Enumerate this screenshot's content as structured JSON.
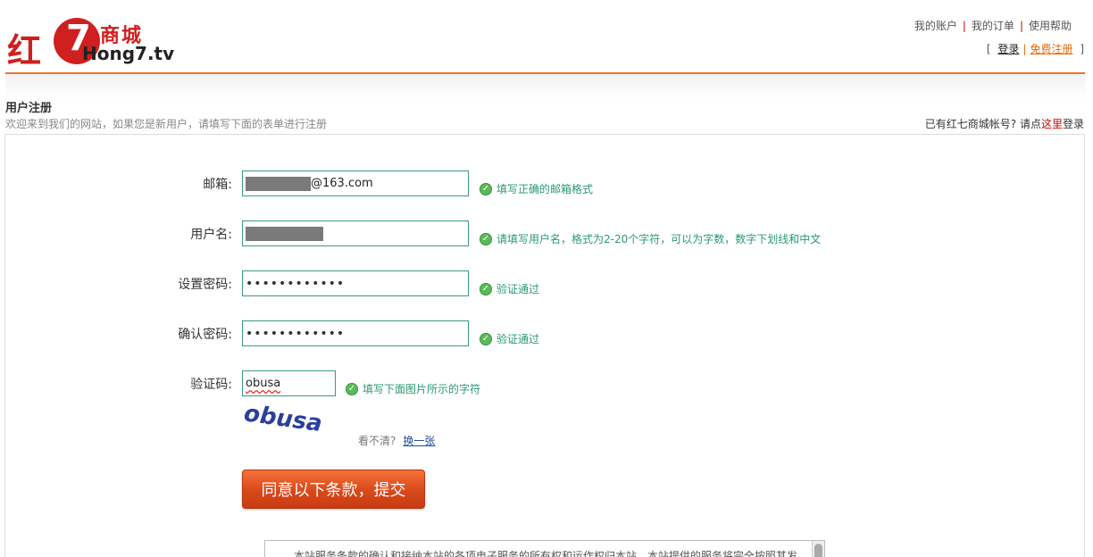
{
  "logo": {
    "red_char": "红",
    "seven": "7",
    "shop": "商城",
    "url": "Hong7.tv"
  },
  "top_links": [
    {
      "label": "我的账户"
    },
    {
      "label": "我的订单"
    },
    {
      "label": "使用帮助"
    }
  ],
  "auth": {
    "open": "[",
    "login": "登录",
    "separator": "|",
    "register": "免费注册",
    "close": "]"
  },
  "page": {
    "title": "用户注册",
    "subtitle": "欢迎来到我们的网站，如果您是新用户，请填写下面的表单进行注册",
    "have_account_prefix": "已有红七商城帐号? 请点",
    "have_account_link": "这里",
    "have_account_suffix": "登录"
  },
  "form": {
    "email": {
      "label": "邮箱:",
      "value_suffix": "@163.com",
      "hint": "填写正确的邮箱格式"
    },
    "username": {
      "label": "用户名:",
      "hint": "请填写用户名，格式为2-20个字符，可以为字数，数字下划线和中文"
    },
    "password": {
      "label": "设置密码:",
      "value": "••••••••••••",
      "hint": "验证通过"
    },
    "confirm": {
      "label": "确认密码:",
      "value": "••••••••••••",
      "hint": "验证通过"
    },
    "captcha": {
      "label": "验证码:",
      "value": "obusa",
      "hint": "填写下面图片所示的字符",
      "image_text": "obusa",
      "unclear": "看不清?",
      "refresh": "换一张"
    },
    "submit": "同意以下条款，提交",
    "terms_preview": "本站服务条款的确认和接纳本站的各项电子服务的所有权和运作权归本站。本站提供的服务将完全按照其发"
  },
  "colors": {
    "accent": "#e8742a",
    "valid": "#2a9a6e",
    "brand_red": "#d01f1f",
    "button": "#d8481a"
  }
}
